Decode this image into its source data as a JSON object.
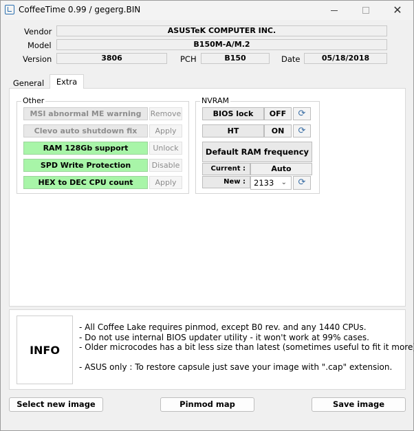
{
  "window": {
    "title": "CoffeeTime 0.99  /  gegerg.BIN",
    "close_glyph": "✕"
  },
  "info_fields": {
    "vendor_label": "Vendor",
    "vendor_value": "ASUSTeK COMPUTER INC.",
    "model_label": "Model",
    "model_value": "B150M-A/M.2",
    "version_label": "Version",
    "version_value": "3806",
    "pch_label": "PCH",
    "pch_value": "B150",
    "date_label": "Date",
    "date_value": "05/18/2018"
  },
  "tabs": [
    {
      "label": "General",
      "active": false
    },
    {
      "label": "Extra",
      "active": true
    }
  ],
  "other_group": {
    "title": "Other",
    "rows": [
      {
        "feature": "MSI abnormal ME warning",
        "action": "Remove",
        "enabled": false
      },
      {
        "feature": "Clevo auto shutdown fix",
        "action": "Apply",
        "enabled": false
      },
      {
        "feature": "RAM 128Gb support",
        "action": "Unlock",
        "enabled": true
      },
      {
        "feature": "SPD Write Protection",
        "action": "Disable",
        "enabled": true
      },
      {
        "feature": "HEX to DEC CPU count",
        "action": "Apply",
        "enabled": true
      }
    ]
  },
  "nvram_group": {
    "title": "NVRAM",
    "bios_lock_label": "BIOS lock",
    "bios_lock_value": "OFF",
    "ht_label": "HT",
    "ht_value": "ON",
    "ram_freq_button": "Default RAM frequency",
    "current_label": "Current :",
    "current_value": "Auto",
    "new_label": "New :",
    "new_value": "2133",
    "refresh_glyph": "⟳"
  },
  "info_panel": {
    "box_label": "INFO",
    "lines": [
      "- All Coffee Lake requires pinmod, except B0 rev. and any 1440 CPUs.",
      "- Do not use internal BIOS updater utility - it won't work at 99% cases.",
      "- Older microcodes has a bit less size than latest (sometimes useful to fit it more).",
      "",
      "- ASUS only : To restore capsule just save your image with \".cap\" extension."
    ]
  },
  "buttons": {
    "select_image": "Select new image",
    "pinmod_map": "Pinmod map",
    "save_image": "Save image"
  },
  "colors": {
    "enabled_green": "#a8f5a8",
    "accent_blue": "#3a6ea5"
  }
}
